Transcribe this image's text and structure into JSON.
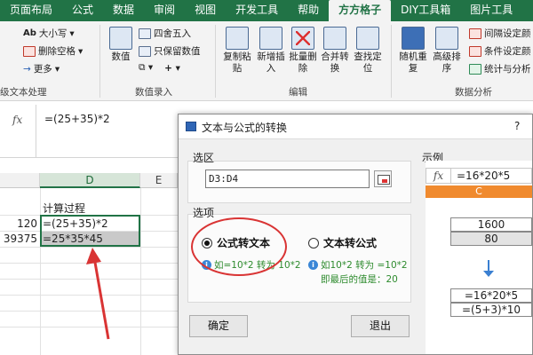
{
  "ribbon_tabs": [
    "页面布局",
    "公式",
    "数据",
    "审阅",
    "视图",
    "开发工具",
    "帮助",
    "方方格子",
    "DIY工具箱",
    "图片工具"
  ],
  "ribbon": {
    "text_group": {
      "items": [
        "大小写",
        "删除空格",
        "更多"
      ],
      "label": "级文本处理"
    },
    "number_group": {
      "big_button": "数值",
      "items": [
        "四舍五入",
        "只保留数值"
      ],
      "label": "数值录入"
    },
    "edit_group": {
      "buttons": [
        "复制粘贴",
        "新增插入",
        "批量删除",
        "合并转换",
        "查找定位"
      ],
      "label": "编辑"
    },
    "analysis_group": {
      "buttons": [
        "随机重复",
        "高级排序"
      ],
      "items": [
        "间隔设定颜",
        "条件设定颜",
        "统计与分析"
      ],
      "label": "数据分析"
    }
  },
  "formula_bar": {
    "fx": "fx",
    "formula": "=(25+35)*2"
  },
  "sheet": {
    "columns": [
      "D",
      "E"
    ],
    "header_cell": "计算过程",
    "rows": [
      {
        "left_value": "120",
        "formula_text": "=(25+35)*2"
      },
      {
        "left_value": "39375",
        "formula_text": "=25*35*45"
      }
    ]
  },
  "dialog": {
    "title": "文本与公式的转换",
    "help": "?",
    "selection_label": "选区",
    "selection_value": "D3:D4",
    "options_label": "选项",
    "option_formula_to_text": "公式转文本",
    "option_text_to_formula": "文本转公式",
    "selected_option": "公式转文本",
    "hint_left": "如=10*2 转为 10*2",
    "hint_right_line1": "如10*2 转为 =10*2",
    "hint_right_line2": "即最后的值是：20",
    "ok_button": "确定",
    "exit_button": "退出",
    "example_label": "示例",
    "example": {
      "formula": "=16*20*5",
      "column": "C",
      "values": [
        "1600",
        "80"
      ],
      "result_texts": [
        "=16*20*5",
        "=(5+3)*10"
      ]
    }
  },
  "colors": {
    "excel_green": "#217346",
    "annotation_red": "#d93434",
    "example_orange": "#f08a2e"
  }
}
